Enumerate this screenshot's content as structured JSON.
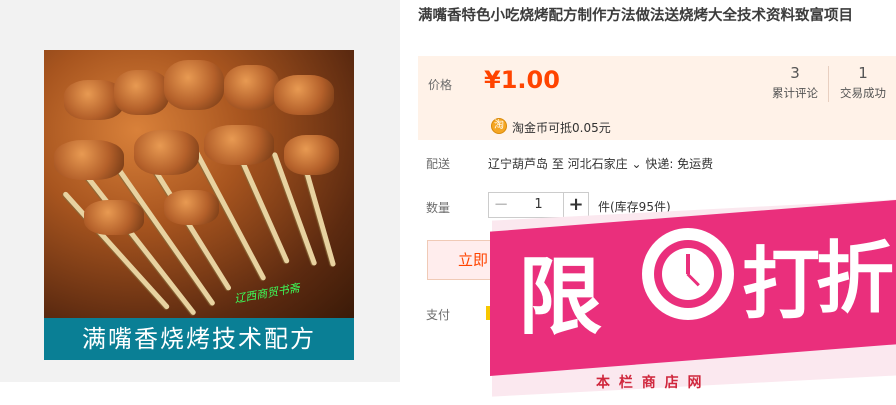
{
  "product": {
    "title": "满嘴香特色小吃烧烤配方制作方法做法送烧烤大全技术资料致富项目",
    "image_caption": "满嘴香烧烤技术配方",
    "image_watermark": "辽西商贸书斋"
  },
  "price": {
    "label": "价格",
    "value": "¥1.00",
    "reviews_count": "3",
    "reviews_label": "累计评论",
    "sales_count": "1",
    "sales_label": "交易成功",
    "coin_icon": "taobao-coin-icon",
    "coin_glyph": "淘",
    "coin_text": "淘金币可抵0.05元"
  },
  "shipping": {
    "label": "配送",
    "text": "辽宁葫芦岛  至  河北石家庄 ⌄ 快递: 免运费"
  },
  "quantity": {
    "label": "数量",
    "minus": "−",
    "value": "1",
    "plus": "+",
    "stock": "件(库存95件)"
  },
  "buy": {
    "label": "立即"
  },
  "payment": {
    "label": "支付"
  },
  "promo": {
    "char1": "限",
    "char2": "打",
    "char3": "折",
    "subtext": "本 栏 商 店 网",
    "color": "#ea2f7c"
  },
  "colors": {
    "price": "#ff4400",
    "caption_bg": "#0a7f95",
    "price_bg": "#fff2e8"
  }
}
